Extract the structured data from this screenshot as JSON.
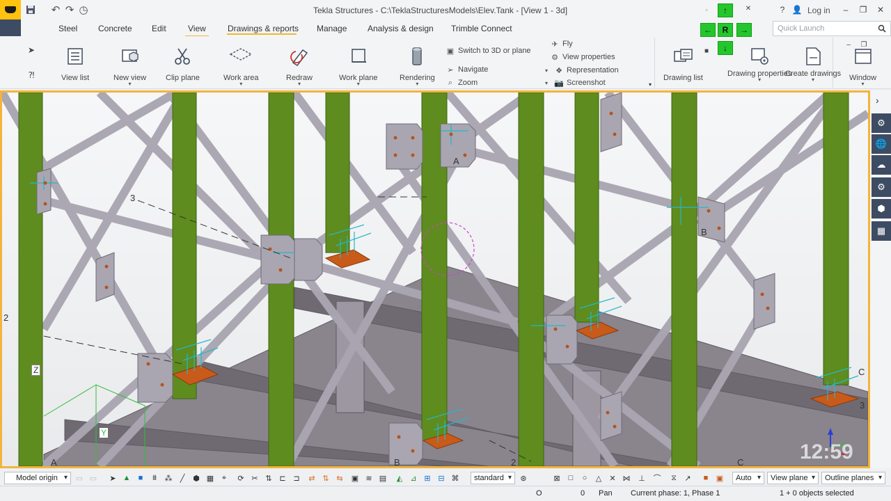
{
  "window": {
    "title": "Tekla Structures - C:\\TeklaStructuresModels\\Elev.Tank - [View 1 - 3d]",
    "login_label": "Log in",
    "help_label": "?",
    "minimize": "–",
    "restore": "❐",
    "close": "✕"
  },
  "menu": {
    "tabs": [
      "Steel",
      "Concrete",
      "Edit",
      "View",
      "Drawings & reports",
      "Manage",
      "Analysis & design",
      "Trimble Connect"
    ],
    "active": "View",
    "quick_launch_placeholder": "Quick Launch"
  },
  "ribbon": {
    "view_list": "View list",
    "new_view": "New view",
    "clip_plane": "Clip plane",
    "work_area": "Work area",
    "redraw": "Redraw",
    "work_plane": "Work plane",
    "rendering": "Rendering",
    "switch_3d": "Switch to 3D or plane",
    "navigate": "Navigate",
    "zoom": "Zoom",
    "fly": "Fly",
    "view_properties": "View properties",
    "representation": "Representation",
    "screenshot": "Screenshot",
    "drawing_list": "Drawing list",
    "drawing_properties": "Drawing properties",
    "create_drawings": "Create drawings",
    "window": "Window"
  },
  "nav": {
    "up": "↑",
    "down": "↓",
    "left": "←",
    "right": "→",
    "reset": "R"
  },
  "viewport": {
    "grid_labels": [
      "3",
      "2",
      "A",
      "B",
      "C",
      "A",
      "B",
      "2",
      "C",
      "3"
    ],
    "axis_labels": [
      "Z",
      "Y"
    ],
    "watermark": "12:59",
    "colors": {
      "column": "#5e8c1f",
      "member": "#a9a6b2",
      "plate": "#c85a1a",
      "frame": "#f4b43a"
    }
  },
  "bottombar": {
    "model_origin": "Model origin",
    "standard": "standard",
    "auto": "Auto",
    "view_plane": "View plane",
    "outline_planes": "Outline planes"
  },
  "status": {
    "coord_o": "O",
    "coord_zero": "0",
    "mode": "Pan",
    "phase": "Current phase: 1, Phase 1",
    "selection": "1 + 0 objects selected"
  }
}
